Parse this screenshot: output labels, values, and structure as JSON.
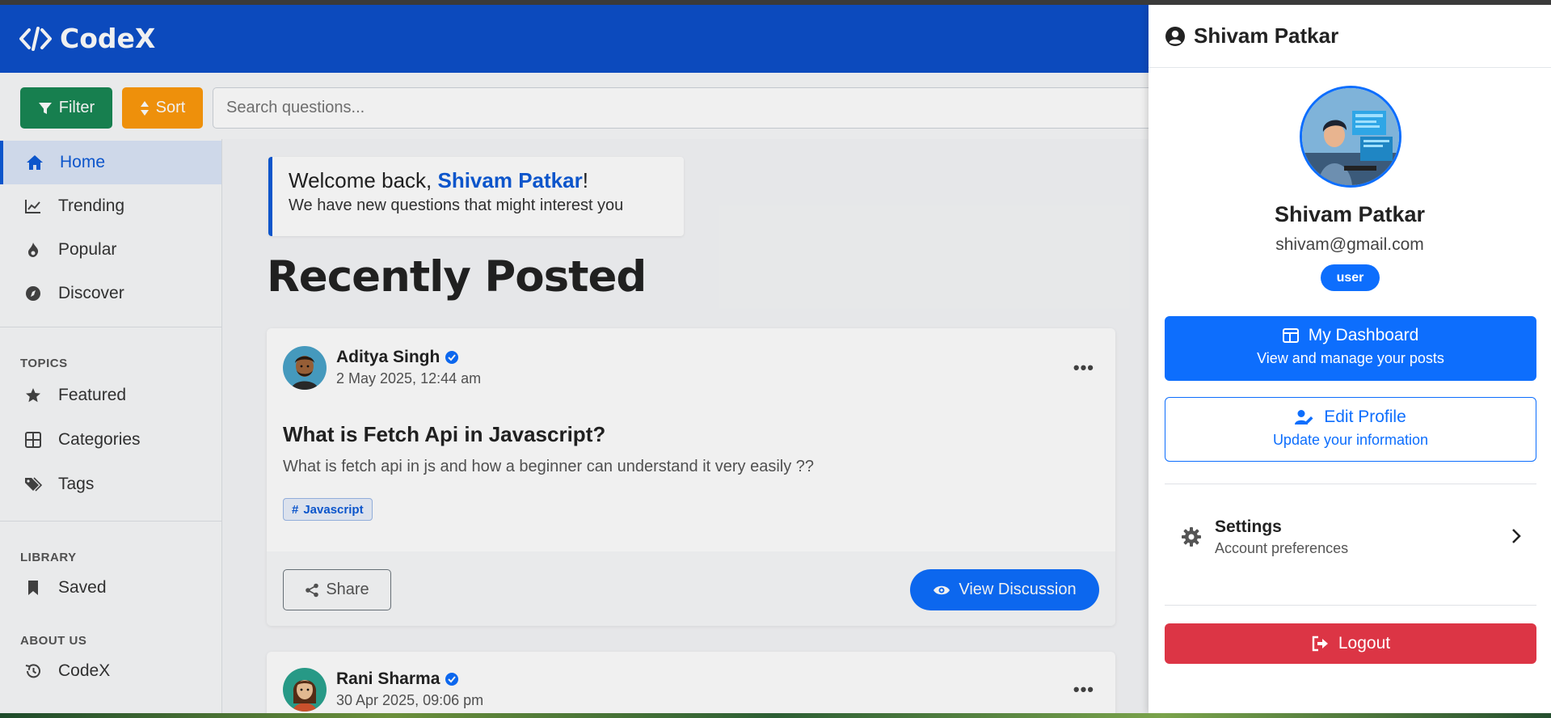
{
  "app": {
    "name": "CodeX"
  },
  "toolbar": {
    "filter_label": "Filter",
    "sort_label": "Sort",
    "search_placeholder": "Search questions..."
  },
  "sidebar": {
    "main_items": [
      {
        "label": "Home",
        "icon": "home-icon",
        "active": true
      },
      {
        "label": "Trending",
        "icon": "trending-icon"
      },
      {
        "label": "Popular",
        "icon": "fire-icon"
      },
      {
        "label": "Discover",
        "icon": "compass-icon"
      }
    ],
    "topics_heading": "TOPICS",
    "topics": [
      {
        "label": "Featured",
        "icon": "star-icon"
      },
      {
        "label": "Categories",
        "icon": "grid-icon"
      },
      {
        "label": "Tags",
        "icon": "tags-icon"
      }
    ],
    "library_heading": "LIBRARY",
    "library": [
      {
        "label": "Saved",
        "icon": "bookmark-icon"
      }
    ],
    "about_heading": "ABOUT US",
    "about": [
      {
        "label": "CodeX",
        "icon": "history-icon"
      }
    ]
  },
  "welcome": {
    "prefix": "Welcome back, ",
    "name": "Shivam Patkar",
    "suffix": "!",
    "subtitle": "We have new questions that might interest you"
  },
  "feed": {
    "heading": "Recently Posted",
    "posts": [
      {
        "author": "Aditya Singh",
        "date": "2 May 2025, 12:44 am",
        "title": "What is Fetch Api in Javascript?",
        "body": "What is fetch api in js and how a beginner can understand it very easily ??",
        "tag": "Javascript",
        "share_label": "Share",
        "view_label": "View Discussion"
      },
      {
        "author": "Rani Sharma",
        "date": "30 Apr 2025, 09:06 pm"
      }
    ]
  },
  "profile_panel": {
    "header_name": "Shivam Patkar",
    "name": "Shivam Patkar",
    "email": "shivam@gmail.com",
    "role": "user",
    "dashboard_title": "My Dashboard",
    "dashboard_sub": "View and manage your posts",
    "edit_title": "Edit Profile",
    "edit_sub": "Update your information",
    "settings_title": "Settings",
    "settings_sub": "Account preferences",
    "logout_label": "Logout"
  },
  "colors": {
    "brand_blue": "#0d4fc9",
    "primary": "#0d6efd",
    "filter_green": "#198754",
    "sort_orange": "#fd9a0c",
    "logout_red": "#dc3545"
  }
}
